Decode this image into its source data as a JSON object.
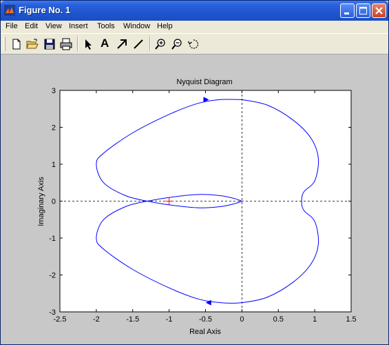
{
  "window": {
    "title": "Figure No. 1"
  },
  "menu": [
    "File",
    "Edit",
    "View",
    "Insert",
    "Tools",
    "Window",
    "Help"
  ],
  "toolbar": {
    "text_tool_label": "A",
    "buttons": [
      "new-file",
      "open-folder",
      "save",
      "print",
      "select-arrow",
      "insert-text",
      "insert-arrow",
      "insert-line",
      "zoom-in",
      "zoom-out",
      "rotate-3d"
    ]
  },
  "colors": {
    "titlebar": "#1f55cf",
    "plot_background": "#ffffff",
    "figure_background": "#c8c8c8",
    "curve": "#0000ff",
    "critical_point": "#ff0000"
  },
  "chart_data": {
    "type": "line",
    "title": "Nyquist Diagram",
    "xlabel": "Real Axis",
    "ylabel": "Imaginary Axis",
    "xlim": [
      -2.5,
      1.5
    ],
    "ylim": [
      -3,
      3
    ],
    "xticks": [
      "-2.5",
      "-2",
      "-1.5",
      "-1",
      "-0.5",
      "0",
      "0.5",
      "1",
      "1.5"
    ],
    "yticks": [
      "-3",
      "-2",
      "-1",
      "0",
      "1",
      "2",
      "3"
    ],
    "grid": false,
    "reference_lines": {
      "x": 0,
      "y": 0,
      "style": "dashed"
    },
    "critical_point": {
      "x": -1,
      "y": 0,
      "marker": "+"
    },
    "series": [
      {
        "x": [
          0,
          0.35,
          0.7,
          0.95,
          1.05,
          1.0,
          0.85,
          0.82,
          0.85,
          1.0,
          1.05,
          0.95,
          0.7,
          0.35,
          0,
          -0.3,
          -0.6,
          -1.0,
          -1.5,
          -1.9,
          -2.0,
          -1.9,
          -1.6,
          -1.3,
          -1.0,
          -0.6,
          -0.3,
          -0.1,
          0
        ],
        "y": [
          2.75,
          2.6,
          2.2,
          1.7,
          1.15,
          0.55,
          0.25,
          0.0,
          -0.25,
          -0.55,
          -1.15,
          -1.7,
          -2.2,
          -2.6,
          -2.75,
          -2.75,
          -2.65,
          -2.35,
          -1.85,
          -1.3,
          -1.0,
          -0.5,
          -0.15,
          0.0,
          0.1,
          0.18,
          0.15,
          0.07,
          0.0
        ]
      },
      {
        "x": [
          0,
          -0.1,
          -0.3,
          -0.6,
          -1.0,
          -1.3,
          -1.6,
          -1.9,
          -2.0,
          -1.9,
          -1.5,
          -1.0,
          -0.6,
          -0.3,
          0
        ],
        "y": [
          0.0,
          -0.07,
          -0.15,
          -0.18,
          -0.1,
          0.0,
          0.15,
          0.5,
          1.0,
          1.3,
          1.85,
          2.35,
          2.65,
          2.75,
          2.75
        ]
      }
    ],
    "direction_arrows": [
      {
        "x": -0.5,
        "y": 2.75,
        "direction": "right"
      },
      {
        "x": -0.45,
        "y": -2.75,
        "direction": "left"
      }
    ]
  }
}
